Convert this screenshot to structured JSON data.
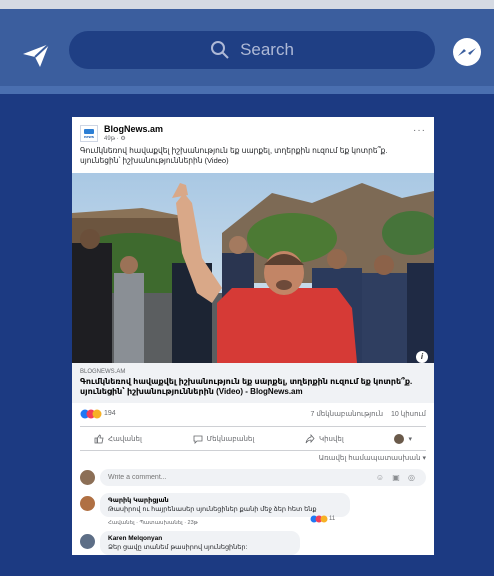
{
  "topbar": {
    "search_placeholder": "Search",
    "left_icon": "paper-plane-icon",
    "right_icon": "messenger-icon"
  },
  "post": {
    "page_name": "BlogNews.am",
    "logo_text": "news",
    "time": "49թ · ⚙",
    "more": "···",
    "text": "Գումկնեռով հավաքվել իշխանություն եք սարքել, տղերքին ուզում եք կոտրե՞ք. սյունեցին՝ իշխանություններին (Video)",
    "link_domain": "BLOGNEWS.AM",
    "link_title": "Գումկնեռով հավաքվել իշխանություն եք սարքել, տղերքին ուզում եք կոտրե՞ք. սյունեցին՝ իշխանություններին (Video) - BlogNews.am",
    "reaction_count": "194",
    "comments_count": "7 մեկնաբանություն",
    "shares_count": "10 կիսում",
    "actions": {
      "like": "Հավանել",
      "comment": "Մեկնաբանել",
      "share": "Կիսվել"
    },
    "sort_label": "Առավել համապատասխան ▾",
    "comment_placeholder": "Write a comment...",
    "input_icons": "☺ ▣ ◎",
    "comments": [
      {
        "name": "Գարիկ Կարիցյան",
        "text": "Թասիրով ու հայրենասեր սյունեցիներ քանի մեջ ձեր հետ ենք",
        "meta": "Հավանել · Պատասխանել · 23թ",
        "reactions": "11"
      },
      {
        "name": "Karen Melqonyan",
        "text": "Ձեր ցավը տանեմ թասիրով սյունեցիներ:"
      }
    ]
  },
  "colors": {
    "page_bg": "#1c3a82",
    "topbar_bg": "#3b5e9e",
    "search_bg": "#1f3f84",
    "card_bg": "#ffffff"
  }
}
